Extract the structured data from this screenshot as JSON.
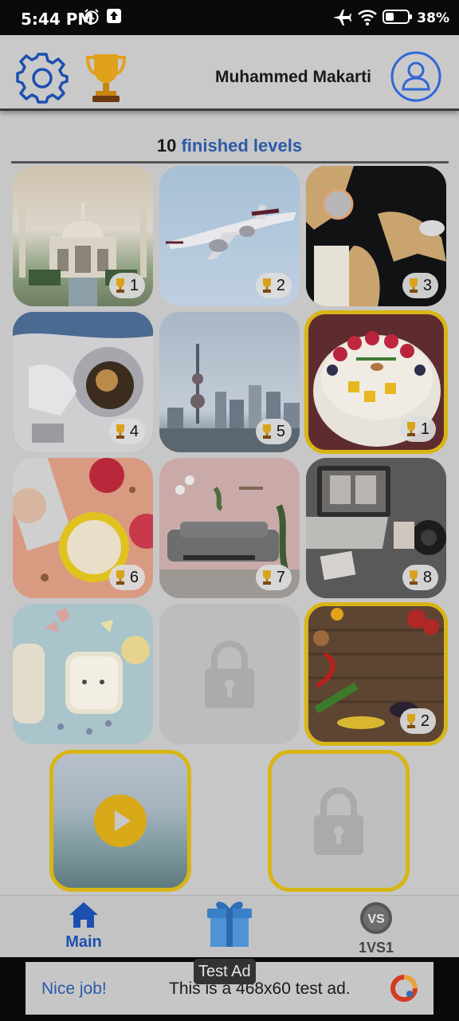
{
  "status_bar": {
    "time": "5:44 PM",
    "battery": "38%"
  },
  "header": {
    "username": "Muhammed Makarti"
  },
  "finished": {
    "count": "10",
    "label": "finished levels"
  },
  "levels": [
    {
      "name": "Taj Mahal",
      "stars": "1",
      "border": "none"
    },
    {
      "name": "Airplane",
      "stars": "2",
      "border": "none"
    },
    {
      "name": "Map",
      "stars": "3",
      "border": "none"
    },
    {
      "name": "Astronaut",
      "stars": "4",
      "border": "none"
    },
    {
      "name": "City skyline",
      "stars": "5",
      "border": "none"
    },
    {
      "name": "Fruit bowl",
      "stars": "1",
      "border": "gold"
    },
    {
      "name": "Cereal",
      "stars": "6",
      "border": "none"
    },
    {
      "name": "Living room",
      "stars": "7",
      "border": "none"
    },
    {
      "name": "Laptop desk",
      "stars": "8",
      "border": "none"
    },
    {
      "name": "Toast",
      "stars": "",
      "border": "none"
    },
    {
      "name": "Locked",
      "stars": "",
      "border": "none"
    },
    {
      "name": "Vegetables",
      "stars": "2",
      "border": "gold"
    }
  ],
  "bottom_nav": {
    "main_label": "Main",
    "vs_label": "1VS1"
  },
  "ad": {
    "tag": "Test Ad",
    "nice": "Nice job!",
    "desc": "This is a 468x60 test ad."
  },
  "colors": {
    "gold": "#d8b516",
    "blue": "#2c5aa8"
  }
}
